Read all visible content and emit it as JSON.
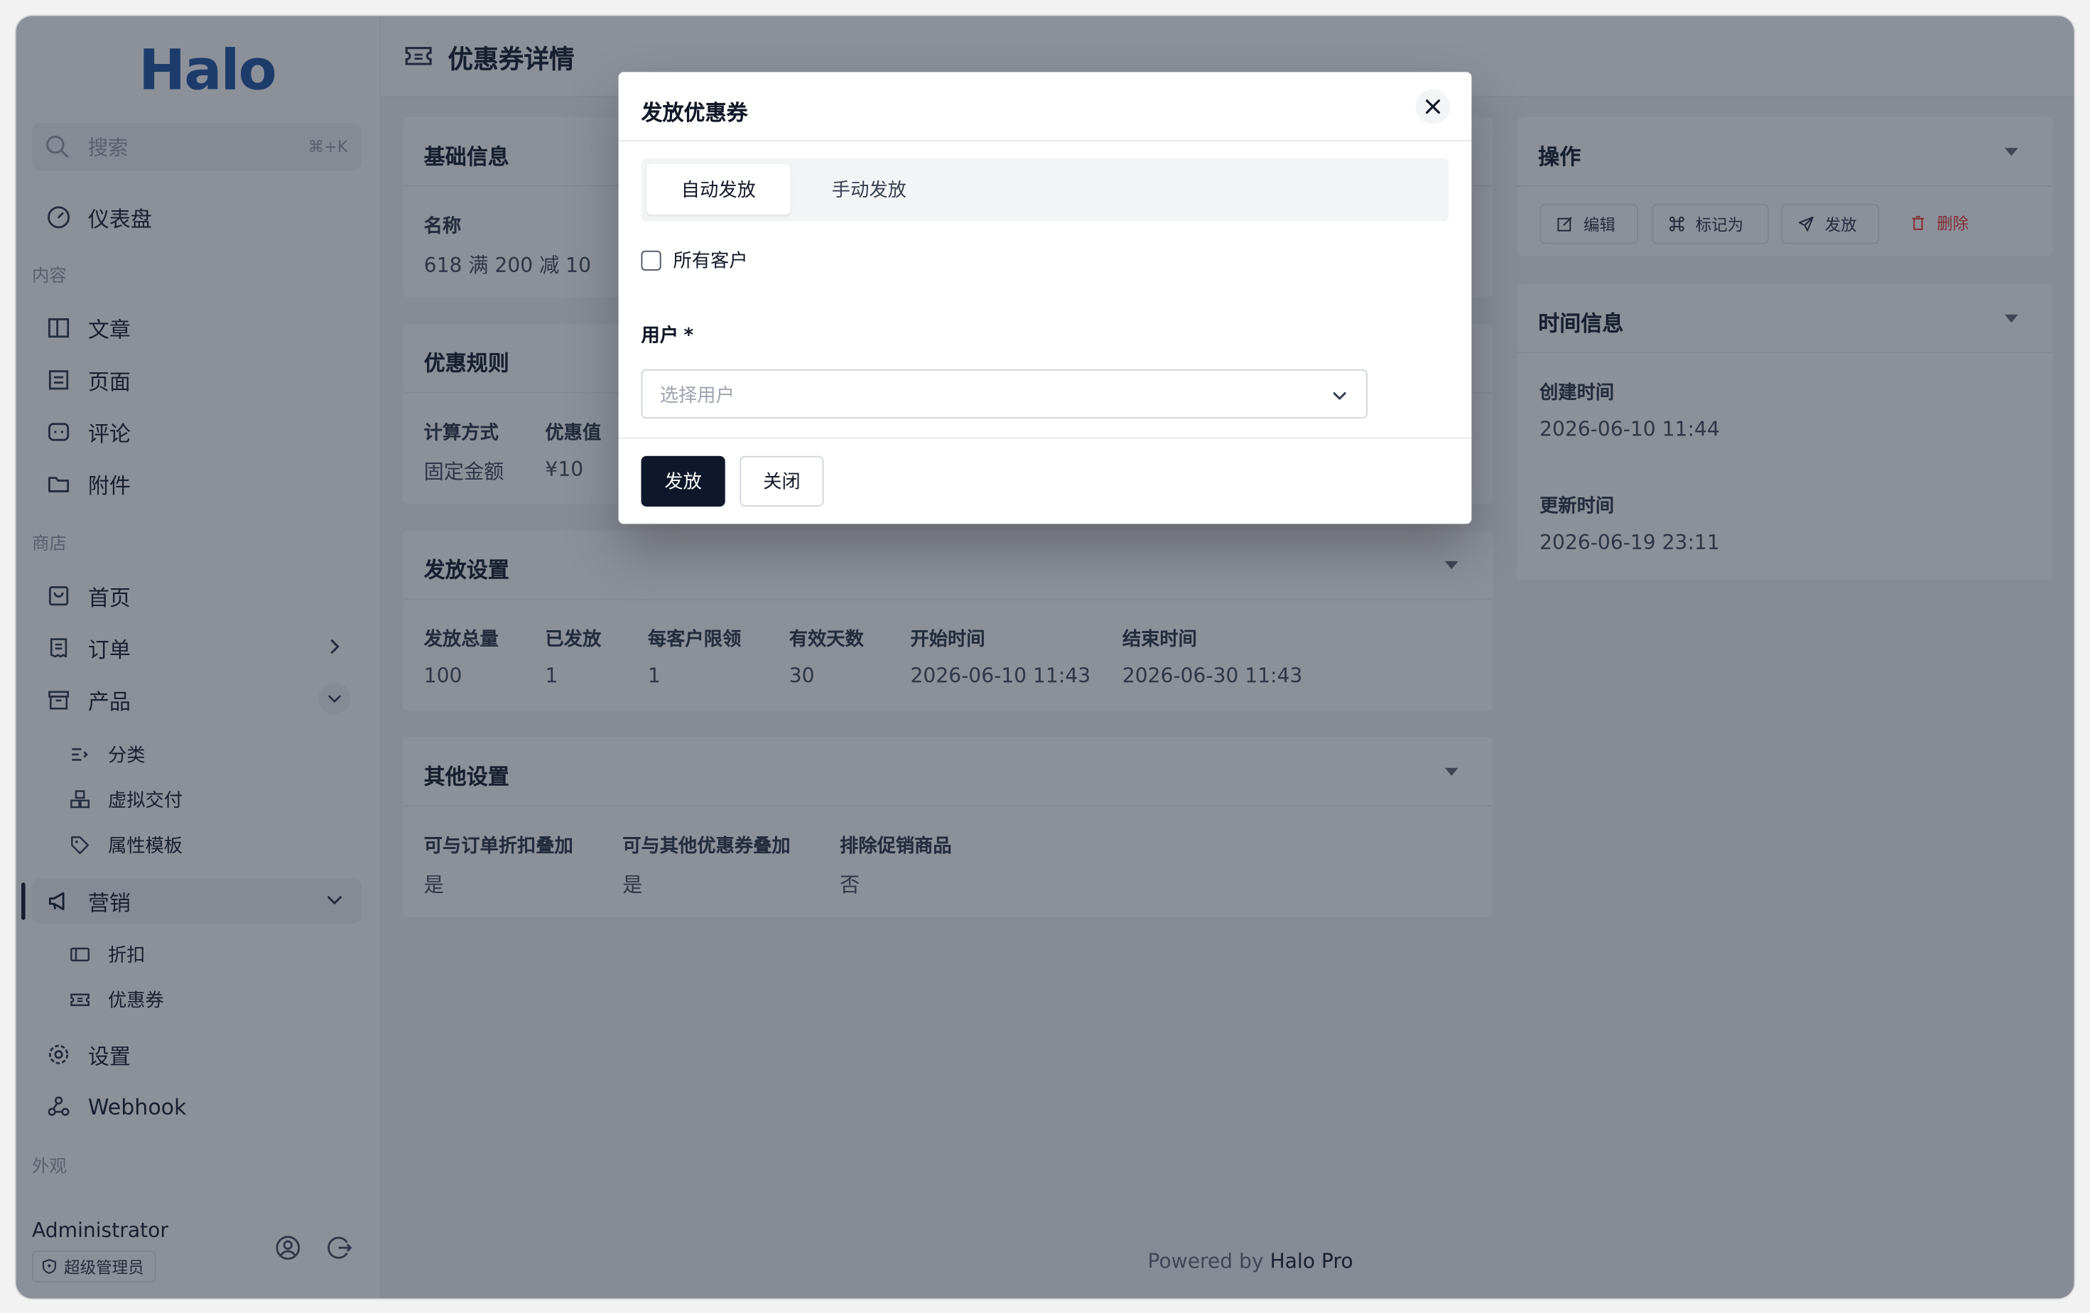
{
  "sidebar": {
    "logo": "Halo",
    "search": {
      "placeholder": "搜索",
      "shortcut": "⌘+K"
    },
    "dashboard": "仪表盘",
    "section_content": "内容",
    "content_items": [
      "文章",
      "页面",
      "评论",
      "附件"
    ],
    "section_shop": "商店",
    "shop_items": {
      "home": "首页",
      "orders": "订单",
      "products": "产品"
    },
    "product_sub": [
      "分类",
      "虚拟交付",
      "属性模板"
    ],
    "marketing": "营销",
    "marketing_sub": [
      "折扣",
      "优惠券"
    ],
    "settings": "设置",
    "webhook": "Webhook",
    "section_appearance": "外观",
    "user": {
      "name": "Administrator",
      "role": "超级管理员"
    }
  },
  "page": {
    "title": "优惠券详情",
    "basic": {
      "title": "基础信息",
      "name_label": "名称",
      "name_value": "618 满 200 减 10"
    },
    "rules": {
      "title": "优惠规则",
      "calc_label": "计算方式",
      "calc_value": "固定金额",
      "discount_label": "优惠值",
      "discount_value": "¥10"
    },
    "issue": {
      "title": "发放设置",
      "fields": [
        {
          "label": "发放总量",
          "value": "100"
        },
        {
          "label": "已发放",
          "value": "1"
        },
        {
          "label": "每客户限领",
          "value": "1"
        },
        {
          "label": "有效天数",
          "value": "30"
        },
        {
          "label": "开始时间",
          "value": "2026-06-10 11:43"
        },
        {
          "label": "结束时间",
          "value": "2026-06-30 11:43"
        }
      ]
    },
    "other": {
      "title": "其他设置",
      "fields": [
        {
          "label": "可与订单折扣叠加",
          "value": "是"
        },
        {
          "label": "可与其他优惠券叠加",
          "value": "是"
        },
        {
          "label": "排除促销商品",
          "value": "否"
        }
      ]
    },
    "actions": {
      "title": "操作",
      "edit": "编辑",
      "mark_as": "标记为",
      "issue": "发放",
      "delete": "删除"
    },
    "time": {
      "title": "时间信息",
      "created_label": "创建时间",
      "created_value": "2026-06-10 11:44",
      "updated_label": "更新时间",
      "updated_value": "2026-06-19 23:11"
    },
    "powered_prefix": "Powered by",
    "powered_brand": "Halo Pro"
  },
  "modal": {
    "title": "发放优惠券",
    "tabs": [
      "自动发放",
      "手动发放"
    ],
    "all_customers_label": "所有客户",
    "user_label": "用户",
    "required_mark": "*",
    "select_placeholder": "选择用户",
    "submit": "发放",
    "close": "关闭"
  },
  "colors": {
    "brand": "#2d5fa8",
    "primary_button": "#0f172a",
    "danger": "#ef4444",
    "overlay": "rgba(15,23,42,0.48)"
  }
}
